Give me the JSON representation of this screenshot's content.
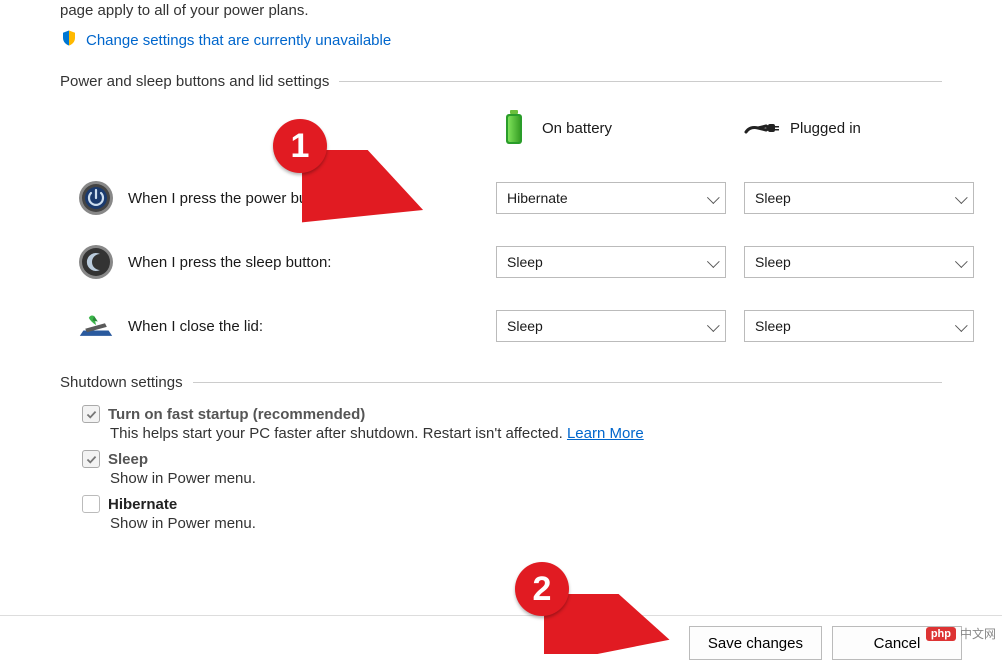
{
  "intro": "page apply to all of your power plans.",
  "change_settings_link": "Change settings that are currently unavailable",
  "group1_title": "Power and sleep buttons and lid settings",
  "headers": {
    "battery": "On battery",
    "plugged": "Plugged in"
  },
  "rows": {
    "power": {
      "label": "When I press the power button:",
      "battery": "Hibernate",
      "plugged": "Sleep"
    },
    "sleep": {
      "label": "When I press the sleep button:",
      "battery": "Sleep",
      "plugged": "Sleep"
    },
    "lid": {
      "label": "When I close the lid:",
      "battery": "Sleep",
      "plugged": "Sleep"
    }
  },
  "group2_title": "Shutdown settings",
  "opts": {
    "fast": {
      "title": "Turn on fast startup (recommended)",
      "desc": "This helps start your PC faster after shutdown. Restart isn't affected. ",
      "link": "Learn More"
    },
    "sleep": {
      "title": "Sleep",
      "desc": "Show in Power menu."
    },
    "hibernate": {
      "title": "Hibernate",
      "desc": "Show in Power menu."
    }
  },
  "buttons": {
    "save": "Save changes",
    "cancel": "Cancel"
  },
  "callouts": {
    "one": "1",
    "two": "2"
  },
  "watermark": {
    "brand": "php",
    "text": "中文网"
  }
}
